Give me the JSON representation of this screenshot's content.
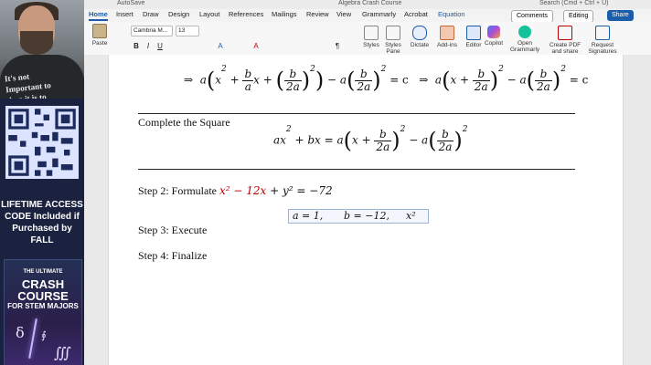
{
  "sidebar": {
    "shirt_text": [
      "It's not",
      "Important to",
      "than it is to"
    ],
    "promo": [
      "LIFETIME ACCESS",
      "CODE Included if",
      "Purchased by FALL"
    ],
    "book": {
      "line1": "THE ULTIMATE",
      "line2a": "CRASH COURSE",
      "line3": "FOR STEM MAJORS"
    }
  },
  "window": {
    "autosave": "AutoSave",
    "doc_title": "Algebra Crash Course",
    "search": "Search (Cmd + Ctrl + U)"
  },
  "tabs": [
    "Home",
    "Insert",
    "Draw",
    "Design",
    "Layout",
    "References",
    "Mailings",
    "Review",
    "View",
    "Grammarly",
    "Acrobat",
    "Equation"
  ],
  "top_buttons": {
    "comments": "Comments",
    "editing": "Editing",
    "share": "Share"
  },
  "ribbon": {
    "paste": "Paste",
    "font": "Cambria M...",
    "size": "13",
    "buttons": [
      "Styles",
      "Styles Pane",
      "Dictate",
      "Add-ins",
      "Editor",
      "Copilot",
      "Open Grammarly",
      "Create PDF and share link",
      "Request Signatures"
    ],
    "format": [
      "B",
      "I",
      "U",
      "A",
      "A",
      "¶"
    ]
  },
  "document": {
    "heading_complete": "Complete the Square",
    "step2_label": "Step 2: Formulate",
    "step3": "Step 3: Execute",
    "step4": "Step 4: Finalize",
    "eq_implies": "⇒",
    "eq_c": "= c",
    "step2_red": "x² − 12x",
    "step2_rest": " + y² = −72",
    "coeffs": {
      "a": "a = 1,",
      "b": "b = −12,",
      "x2": "x²"
    }
  },
  "colors": {
    "accent": "#1a5dab",
    "highlight_red": "#c00000",
    "share_bg": "#1a5dab"
  }
}
